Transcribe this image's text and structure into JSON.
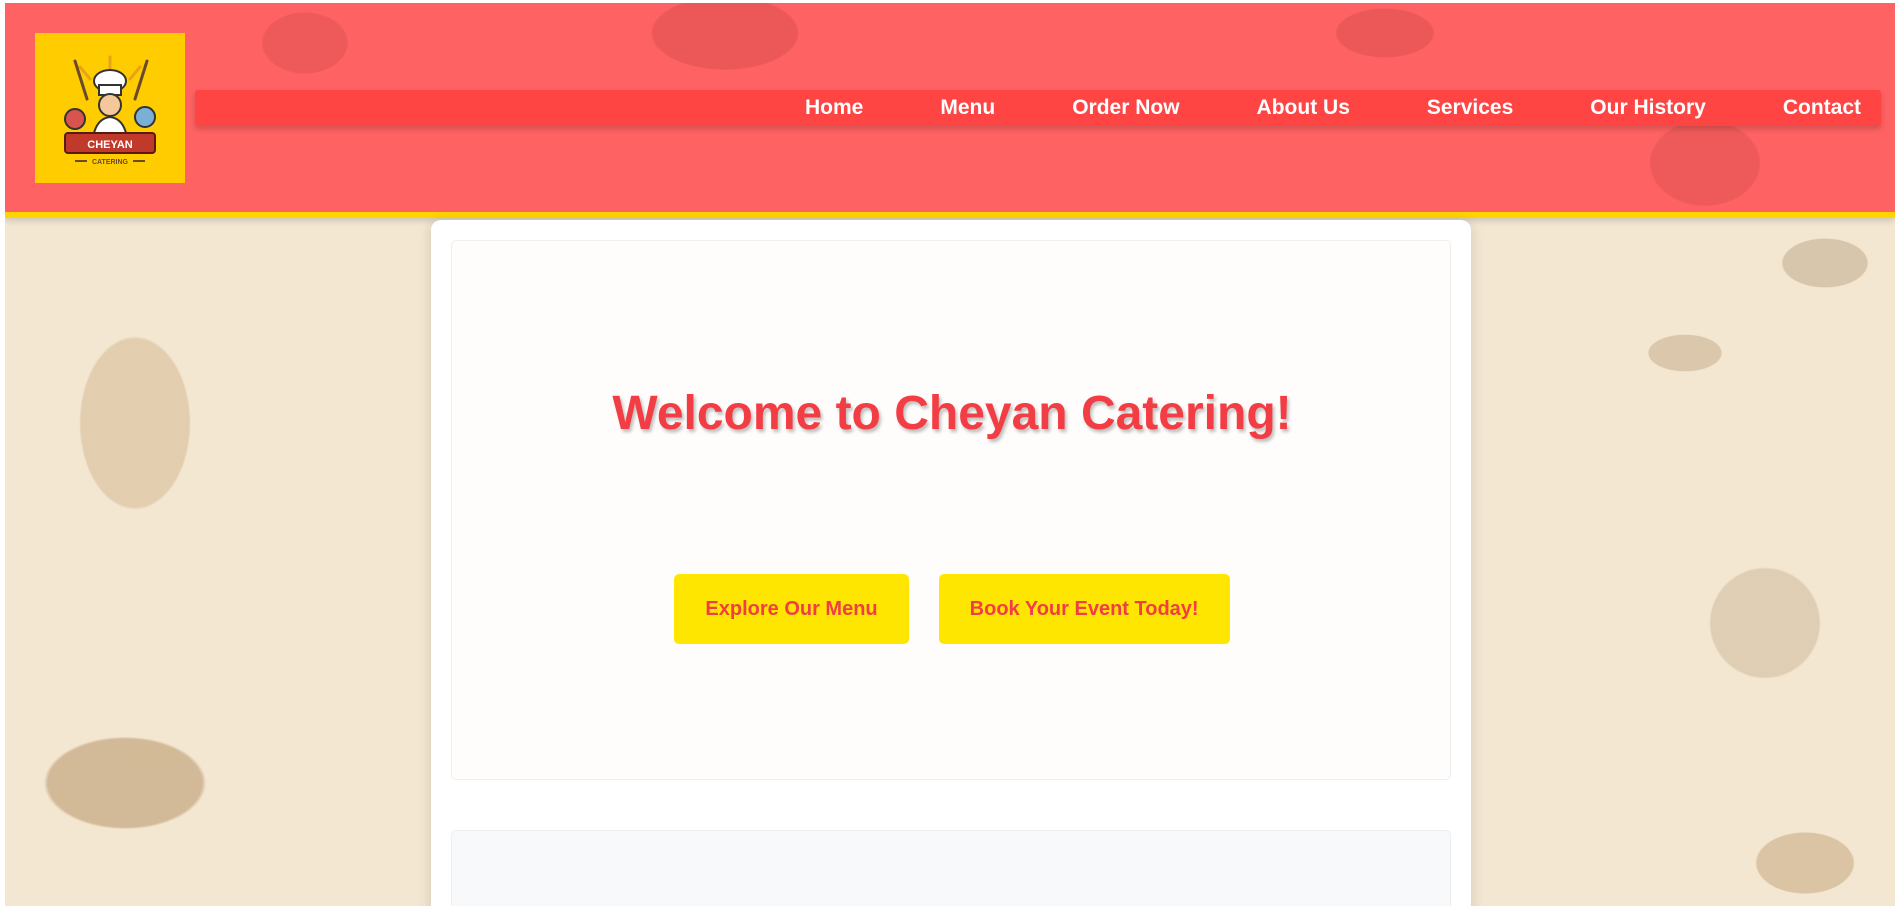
{
  "logo": {
    "icon": "chef-logo-icon",
    "brand_text": "CHEYAN",
    "sub_text": "CATERING",
    "background_color": "#ffcc00"
  },
  "nav": {
    "items": [
      {
        "label": "Home"
      },
      {
        "label": "Menu"
      },
      {
        "label": "Order Now"
      },
      {
        "label": "About Us"
      },
      {
        "label": "Services"
      },
      {
        "label": "Our History"
      },
      {
        "label": "Contact"
      }
    ],
    "bar_color": "#ff4444"
  },
  "hero": {
    "title": "Welcome to Cheyan Catering!",
    "buttons": [
      {
        "label": "Explore Our Menu"
      },
      {
        "label": "Book Your Event Today!"
      }
    ]
  },
  "colors": {
    "header": "#ff6262",
    "accent_yellow": "#ffe600",
    "accent_red": "#f23d44",
    "page_background": "#f3e7d2"
  }
}
